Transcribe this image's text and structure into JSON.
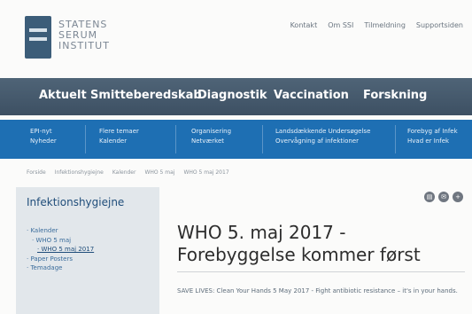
{
  "logo": {
    "line1": "STATENS",
    "line2": "SERUM",
    "line3": "INSTITUT"
  },
  "utility_links": [
    "Kontakt",
    "Om SSI",
    "Tilmeldning",
    "Supportsiden"
  ],
  "main_nav": [
    "Aktuelt",
    "Smitteberedskab",
    "Diagnostik",
    "Vaccination",
    "Forskning"
  ],
  "sub_nav": [
    {
      "line1": "EPI-nyt",
      "line2": "Nyheder"
    },
    {
      "line1": "Flere temaer",
      "line2": "Kalender"
    },
    {
      "line1": "Organisering",
      "line2": "Netværket"
    },
    {
      "line1": "Landsdækkende Undersøgelse",
      "line2": "Overvågning af infektioner"
    },
    {
      "line1": "Forebyg af Infek",
      "line2": "Hvad er Infek"
    }
  ],
  "breadcrumb": [
    "Forside",
    "Infektionshygiejne",
    "Kalender",
    "WHO 5 maj",
    "WHO 5 maj 2017"
  ],
  "sidebar": {
    "title": "Infektionshygiejne",
    "items": [
      {
        "label": "Kalender",
        "level": 1
      },
      {
        "label": "WHO 5 maj",
        "level": 2
      },
      {
        "label": "WHO 5 maj 2017",
        "level": 3
      },
      {
        "label": "Paper Posters",
        "level": 1
      },
      {
        "label": "Temadage",
        "level": 1
      }
    ]
  },
  "content": {
    "title": "WHO 5. maj 2017 - Forebyggelse kommer først",
    "body": "SAVE LIVES: Clean Your Hands 5 May 2017 - Fight antibiotic resistance – it's in your hands."
  }
}
